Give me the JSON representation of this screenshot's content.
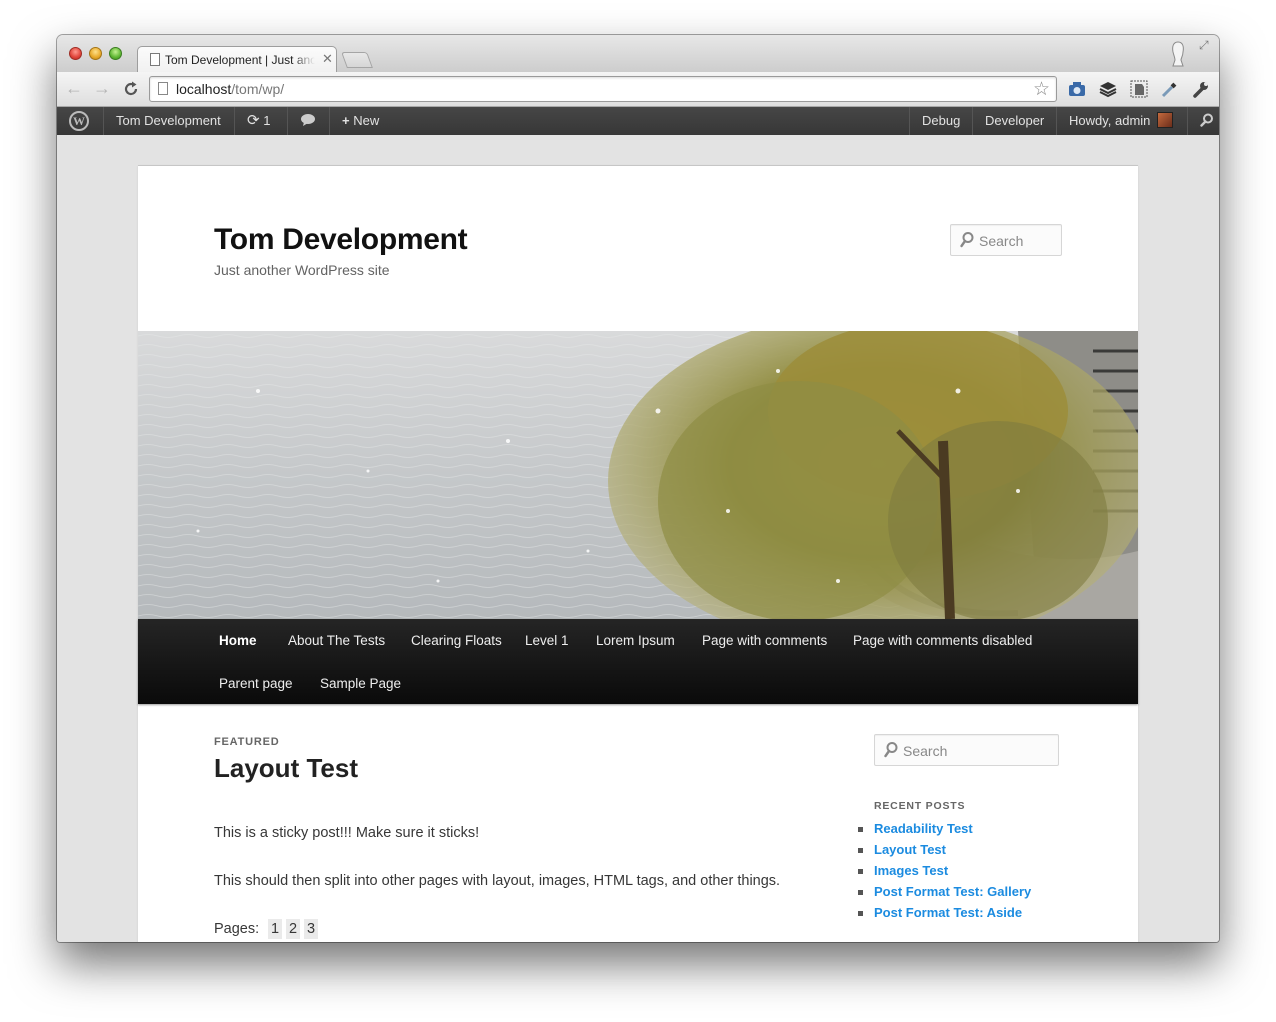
{
  "browser": {
    "tab_title": "Tom Development | Just another WordPress site",
    "tab_close_glyph": "✕",
    "url_host": "localhost",
    "url_path": "/tom/wp/",
    "nav": {
      "back_glyph": "←",
      "forward_glyph": "→",
      "reload_glyph": "C"
    },
    "icons": [
      "page-icon",
      "bookmark-star-icon",
      "extension-camera-icon",
      "extension-layers-icon",
      "extension-evernote-icon",
      "extension-eyedropper-icon",
      "wrench-icon",
      "profile-icon",
      "fullscreen-icon"
    ]
  },
  "adminbar": {
    "site_name": "Tom Development",
    "updates_count": "1",
    "new_label": "New",
    "debug_label": "Debug",
    "developer_label": "Developer",
    "howdy_label": "Howdy, admin",
    "wp_logo_glyph": "W"
  },
  "site": {
    "title": "Tom Development",
    "description": "Just another WordPress site",
    "search_placeholder": "Search"
  },
  "menu": {
    "items": [
      "Home",
      "About The Tests",
      "Clearing Floats",
      "Level 1",
      "Lorem Ipsum",
      "Page with comments",
      "Page with comments disabled",
      "Parent page",
      "Sample Page"
    ],
    "current": "Home"
  },
  "post": {
    "label": "FEATURED",
    "title": "Layout Test",
    "paragraphs": [
      "This is a sticky post!!! Make sure it sticks!",
      "This should then split into other pages with layout, images, HTML tags, and other things."
    ],
    "pages_label": "Pages:",
    "pages": [
      "1",
      "2",
      "3"
    ]
  },
  "sidebar": {
    "search_placeholder": "Search",
    "recent_title": "RECENT POSTS",
    "recent_posts": [
      "Readability Test",
      "Layout Test",
      "Images Test",
      "Post Format Test: Gallery",
      "Post Format Test: Aside"
    ]
  },
  "colors": {
    "link": "#1b8be0",
    "adminbar": "#464646",
    "menu_bar": "#111111"
  }
}
